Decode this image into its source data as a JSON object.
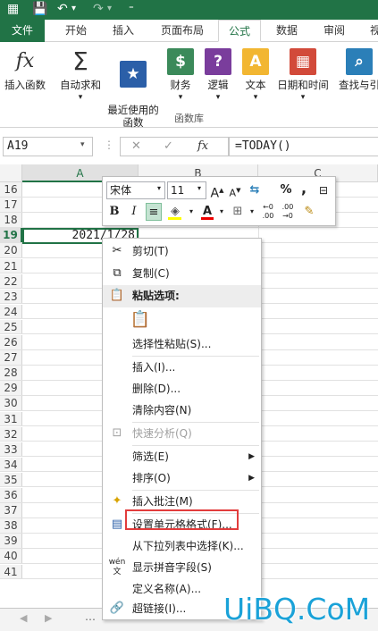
{
  "quick_access": {
    "save_icon": "save-icon",
    "undo": "↶",
    "redo": "↷"
  },
  "tabs": [
    {
      "label": "文件"
    },
    {
      "label": "开始"
    },
    {
      "label": "插入"
    },
    {
      "label": "页面布局"
    },
    {
      "label": "公式"
    },
    {
      "label": "数据"
    },
    {
      "label": "审阅"
    },
    {
      "label": "视"
    }
  ],
  "ribbon": {
    "group_label": "函数库",
    "buttons": [
      {
        "label": "插入函数",
        "icon": "fx-icon"
      },
      {
        "label": "自动求和",
        "icon": "sigma-icon"
      },
      {
        "label": "最近使用的\n函数",
        "icon": "star-icon"
      },
      {
        "label": "财务",
        "icon": "finance-icon"
      },
      {
        "label": "逻辑",
        "icon": "logic-icon"
      },
      {
        "label": "文本",
        "icon": "text-icon"
      },
      {
        "label": "日期和时间",
        "icon": "calendar-icon"
      },
      {
        "label": "查找与引",
        "icon": "lookup-icon"
      }
    ]
  },
  "formula_bar": {
    "name_box": "A19",
    "fx": "fx",
    "formula": "=TODAY()"
  },
  "columns": [
    "A",
    "B",
    "C"
  ],
  "rows": [
    "16",
    "17",
    "18",
    "19",
    "20",
    "21",
    "22",
    "23",
    "24",
    "25",
    "26",
    "27",
    "28",
    "29",
    "30",
    "31",
    "32",
    "33",
    "34",
    "35",
    "36",
    "37",
    "38",
    "39",
    "40",
    "41"
  ],
  "active_cell": {
    "row": "19",
    "value": "2021/1/28"
  },
  "mini_toolbar": {
    "font": "宋体",
    "size": "11",
    "percent": "%",
    "comma": ",",
    "bold": "B",
    "italic": "I"
  },
  "context_menu": {
    "items": [
      {
        "label": "剪切(T)",
        "icon": "scissors-icon"
      },
      {
        "label": "复制(C)",
        "icon": "copy-icon"
      },
      {
        "label": "粘贴选项:",
        "icon": "paste-icon"
      },
      {
        "label": "",
        "icon": "paste-clipboard-icon"
      },
      {
        "label": "选择性粘贴(S)...",
        "icon": ""
      },
      {
        "label": "插入(I)...",
        "icon": ""
      },
      {
        "label": "删除(D)...",
        "icon": ""
      },
      {
        "label": "清除内容(N)",
        "icon": ""
      },
      {
        "label": "快速分析(Q)",
        "icon": "quick-analysis-icon"
      },
      {
        "label": "筛选(E)",
        "icon": ""
      },
      {
        "label": "排序(O)",
        "icon": ""
      },
      {
        "label": "插入批注(M)",
        "icon": "comment-icon"
      },
      {
        "label": "设置单元格格式(F)...",
        "icon": "format-cells-icon"
      },
      {
        "label": "从下拉列表中选择(K)...",
        "icon": ""
      },
      {
        "label": "显示拼音字段(S)",
        "icon": "pinyin-icon"
      },
      {
        "label": "定义名称(A)...",
        "icon": ""
      },
      {
        "label": "超链接(I)...",
        "icon": "hyperlink-icon"
      }
    ]
  },
  "watermark": "UiBQ.CoM",
  "colors": {
    "excel_green": "#217346",
    "highlight": "#e23c3c",
    "watermark": "#1aa2d8"
  }
}
